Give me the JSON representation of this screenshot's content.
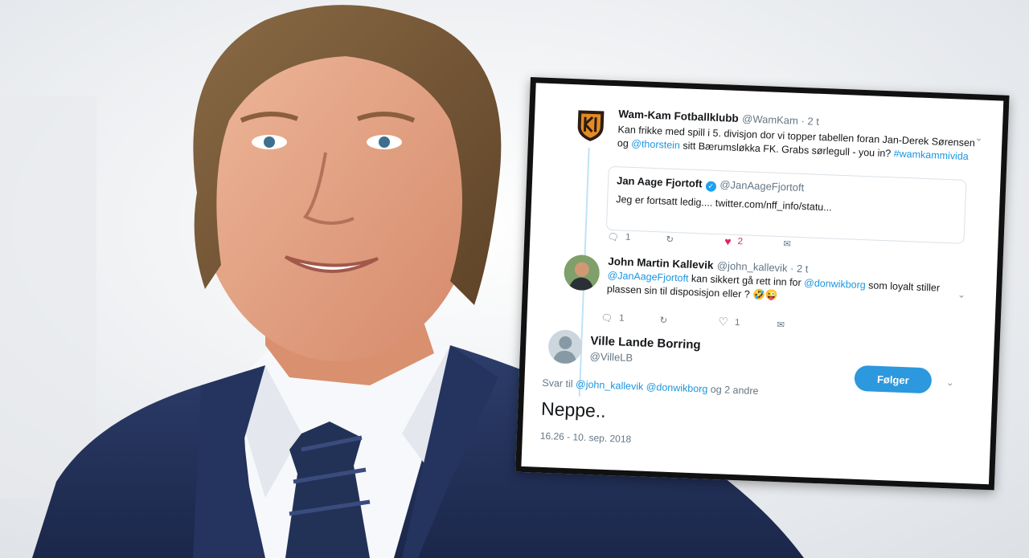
{
  "tweet1": {
    "name": "Wam-Kam Fotballklubb",
    "handle": "@WamKam · 2 t",
    "text_a": "Kan frikke med spill i 5. divisjon dor vi topper tabellen foran Jan-Derek Sørensen",
    "text_b1": "og ",
    "mention": "@thorstein",
    "text_b2": " sitt Bærumsløkka FK. Grabs sørlegull - you in? ",
    "hashtag": "#wamkammivida",
    "quote_name": "Jan Aage Fjortoft",
    "quote_handle": "@JanAageFjortoft",
    "quote_text": "Jeg er fortsatt ledig.... twitter.com/nff_info/statu...",
    "reply_count": "1",
    "like_count": "2"
  },
  "tweet2": {
    "name": "John Martin Kallevik",
    "handle": "@john_kallevik · 2 t",
    "mention1": "@JanAageFjortoft",
    "text_a": " kan sikkert gå rett inn for ",
    "mention2": "@donwikborg",
    "text_b": " som loyalt stiller",
    "text_c": "plassen sin til disposisjon eller ? 🤣😜",
    "reply_count": "1",
    "like_count": "1"
  },
  "tweet3": {
    "name": "Ville Lande Borring",
    "handle": "@VilleLB",
    "follow_label": "Følger",
    "reply_prefix": "Svar til ",
    "reply_mention1": "@john_kallevik",
    "reply_mention2": "@donwikborg",
    "reply_suffix": " og 2 andre",
    "text": "Neppe..",
    "timestamp": "16.26 - 10. sep. 2018"
  },
  "colors": {
    "link": "#1b95e0",
    "like": "#e0245e",
    "follow_button": "#2c98dd"
  }
}
